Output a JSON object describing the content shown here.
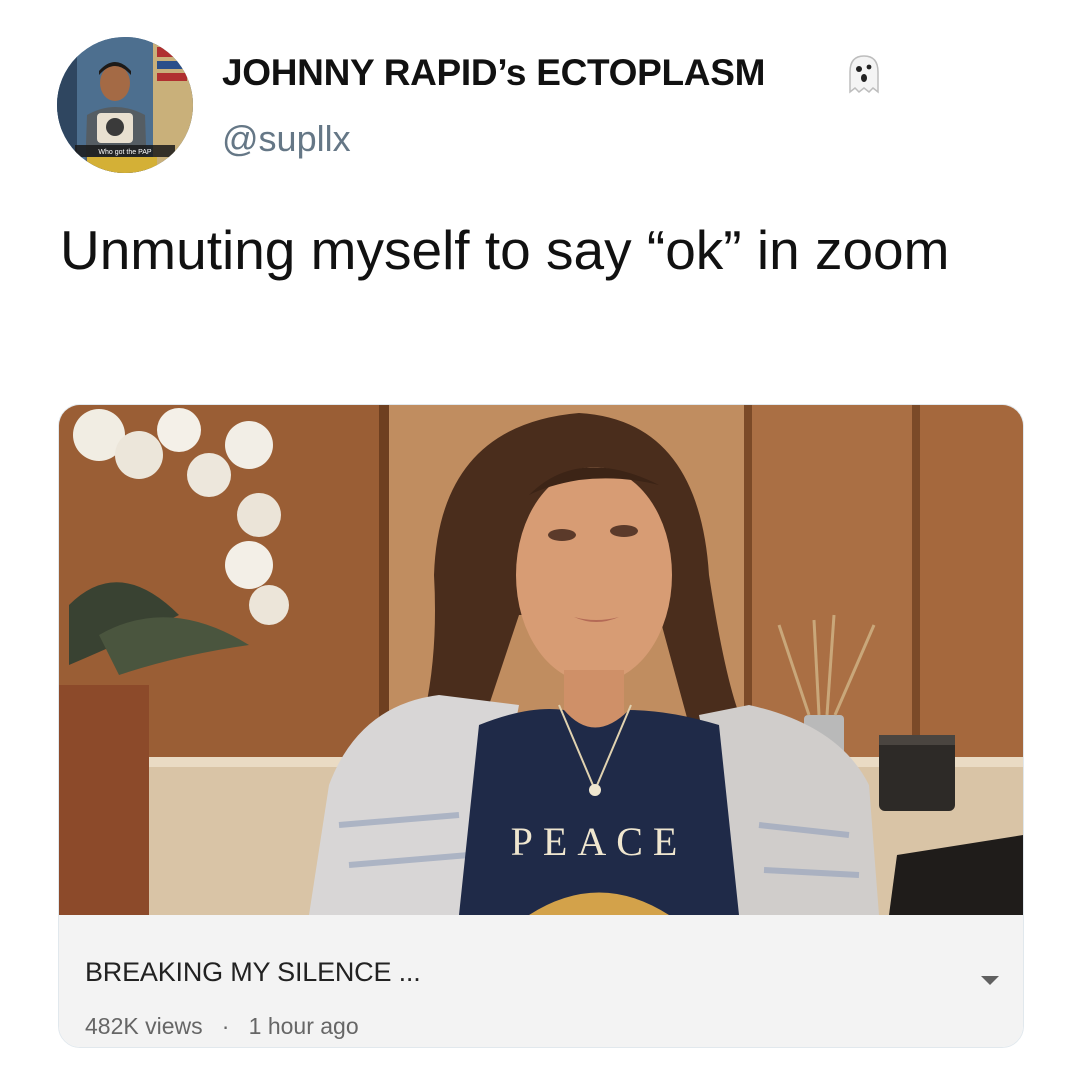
{
  "author": {
    "display_name": "JOHNNY RAPID’s ECTOPLASM",
    "name_emoji": "ghost-icon",
    "handle": "@supllx",
    "avatar_caption": "Who got the PAP"
  },
  "tweet": {
    "text": "Unmuting myself to say “ok” in zoom"
  },
  "video_card": {
    "shirt_text": "PEACE",
    "title": "BREAKING MY SILENCE ...",
    "views": "482K views",
    "separator": "·",
    "age": "1 hour ago",
    "expand_icon": "chevron-down-icon"
  },
  "colors": {
    "handle": "#657786",
    "card_bar": "#f3f3f3",
    "wood": "#a8693f"
  }
}
